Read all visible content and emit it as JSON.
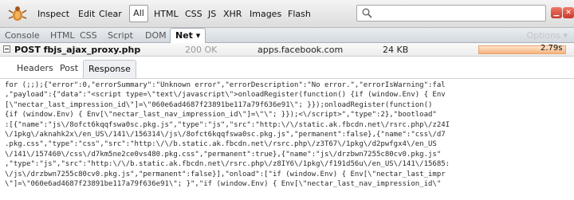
{
  "toolbar": {
    "items": [
      "Inspect",
      "Edit",
      "Clear"
    ],
    "filter_all": "All",
    "filters": [
      "HTML",
      "CSS",
      "JS",
      "XHR",
      "Images",
      "Flash"
    ]
  },
  "panel_tabs": {
    "tabs": [
      "Console",
      "HTML",
      "CSS",
      "Script",
      "DOM"
    ],
    "active": "Net ▾",
    "options": "Options ▾"
  },
  "request": {
    "method_url": "POST fbjs_ajax_proxy.php",
    "status": "200 OK",
    "domain": "apps.facebook.com",
    "size": "24 KB",
    "time": "2.79s"
  },
  "detail_tabs": {
    "headers": "Headers",
    "post": "Post",
    "response": "Response"
  },
  "response_lines": [
    "for (;;);{\"error\":0,\"errorSummary\":\"Unknown error\",\"errorDescription\":\"No error.\",\"errorIsWarning\":fal",
    ",\"payload\":{\"data\":\"<script type=\\\"text\\/javascript\\\">onloadRegister(function() {if (window.Env) { Env",
    "[\\\"nectar_last_impression_id\\\"]=\\\"060e6ad4687f23891be117a79f636e91\\\"; }});onloadRegister(function()",
    "{if (window.Env) { Env[\\\"nectar_last_nav_impression_id\\\"]=\\\"\\\"; }});<\\/script>\",\"type\":2},\"bootload\"",
    ":[{\"name\":\"js\\/8ofct6kqqfswa0sc.pkg.js\",\"type\":\"js\",\"src\":\"http:\\/\\/static.ak.fbcdn.net\\/rsrc.php\\/z24I",
    "\\/1pkg\\/aknahk2x\\/en_US\\/141\\/156314\\/js\\/8ofct6kqqfswa0sc.pkg.js\",\"permanent\":false},{\"name\":\"css\\/d7",
    ".pkg.css\",\"type\":\"css\",\"src\":\"http:\\/\\/b.static.ak.fbcdn.net\\/rsrc.php\\/z3T67\\/1pkg\\/d2pwfgx4\\/en_US",
    "\\/141\\/157460\\/css\\/d7km5ne2ce0vs480.pkg.css\",\"permanent\":true},{\"name\":\"js\\/drzbwn7255c80cv0.pkg.js\"",
    ",\"type\":\"js\",\"src\":\"http:\\/\\/b.static.ak.fbcdn.net\\/rsrc.php\\/z8IY6\\/1pkg\\/f191d56u\\/en_US\\/141\\/15685:",
    "\\/js\\/drzbwn7255c80cv0.pkg.js\",\"permanent\":false}],\"onload\":[\"if (window.Env) { Env[\\\"nectar_last_impr",
    "\\\"]=\\\"060e6ad4687f23891be117a79f636e91\\\"; }\",\"if (window.Env) { Env[\\\"nectar_last_nav_impression_id\\\""
  ]
}
